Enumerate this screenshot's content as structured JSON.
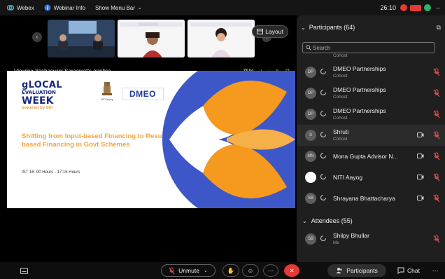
{
  "topbar": {
    "app_name": "Webex",
    "webinar_info": "Webinar Info",
    "show_menu_bar": "Show Menu Bar",
    "time": "26:10"
  },
  "stage": {
    "layout_label": "Layout",
    "viewing_text": "Viewing Yashaswini Saraswat's applica...",
    "zoom_level": "75%"
  },
  "slide": {
    "logo_line1": "gLOCAL",
    "logo_line2": "EVALUATION",
    "logo_line3": "WEEK",
    "logo_line4": "powered by GEI",
    "emblem_caption": "NITI Aayog",
    "dmeo_logo": "DMEO",
    "headline": "Shifting from Input-based Financing to Result-based Financing in Govt Schemes",
    "time_text": "IST 16: 00 Hours - 17:15 Hours"
  },
  "panel": {
    "title": "Participants (64)",
    "search_placeholder": "Search",
    "partial_role": "Cohost",
    "participants": [
      {
        "initials": "DP",
        "name": "DMEO Partnerships",
        "role": "Cohost",
        "camera": false
      },
      {
        "initials": "DP",
        "name": "DMEO Partnerships",
        "role": "Cohost",
        "camera": false
      },
      {
        "initials": "DP",
        "name": "DMEO Partnerships",
        "role": "Cohost",
        "camera": false
      },
      {
        "initials": "S",
        "name": "Shruti",
        "role": "Cohost",
        "camera": true
      },
      {
        "initials": "MN",
        "name": "Mona Gupta Advisor N...",
        "role": "",
        "camera": true
      },
      {
        "initials": "",
        "name": "NITI Aayog",
        "role": "",
        "camera": true
      },
      {
        "initials": "SB",
        "name": "Shrayana Bhattacharya",
        "role": "",
        "camera": true
      }
    ],
    "attendees_label": "Attendees (55)",
    "attendee": {
      "initials": "SB",
      "name": "Shilpy Bhullar",
      "role": "Me"
    }
  },
  "bottombar": {
    "unmute": "Unmute",
    "participants": "Participants",
    "chat": "Chat"
  },
  "colors": {
    "accent_red": "#e53935",
    "slide_orange": "#f5a43a",
    "slide_blue": "#3d57c9"
  }
}
